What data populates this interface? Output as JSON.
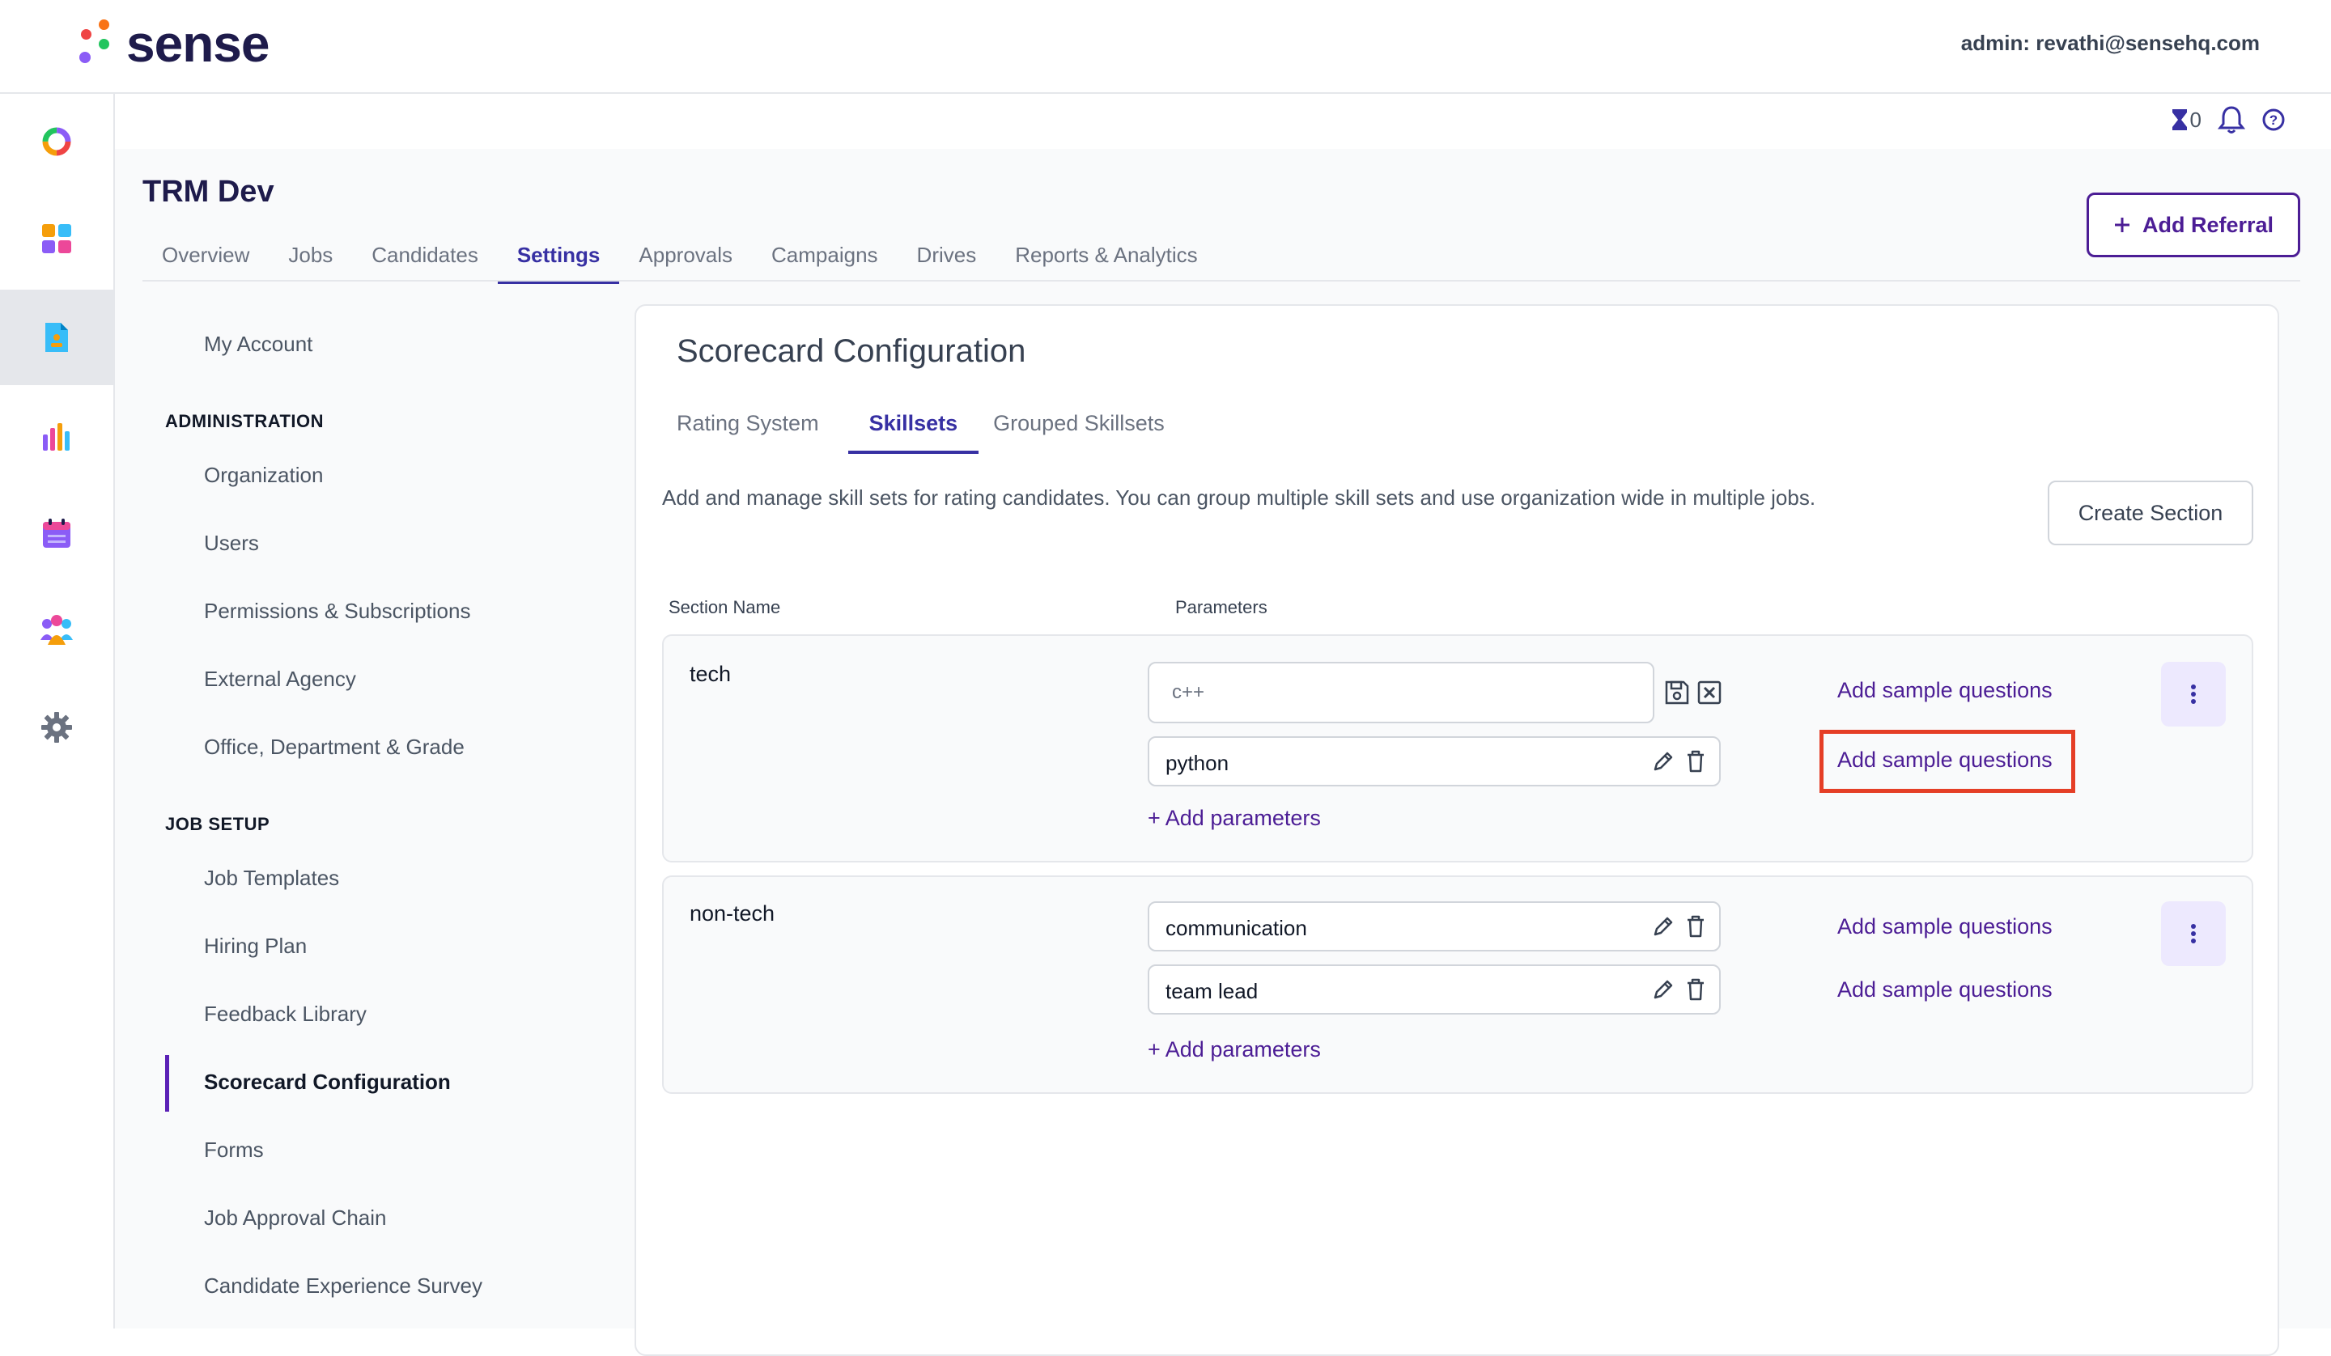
{
  "app": {
    "logo_text": "sense",
    "admin_label": "admin: revathi@sensehq.com",
    "notification_count": "0"
  },
  "rail": {
    "icons": [
      "donut-logo-icon",
      "dashboard-grid-icon",
      "document-icon",
      "analytics-icon",
      "calendar-icon",
      "people-icon",
      "settings-gear-icon"
    ],
    "active_index": 2
  },
  "header": {
    "title": "TRM Dev",
    "tabs": [
      "Overview",
      "Jobs",
      "Candidates",
      "Settings",
      "Approvals",
      "Campaigns",
      "Drives",
      "Reports & Analytics"
    ],
    "active_tab": "Settings",
    "add_referral_label": "Add Referral"
  },
  "settings_nav": {
    "my_account": "My Account",
    "administration_heading": "ADMINISTRATION",
    "administration": [
      "Organization",
      "Users",
      "Permissions & Subscriptions",
      "External Agency",
      "Office, Department & Grade"
    ],
    "job_setup_heading": "JOB SETUP",
    "job_setup": [
      "Job Templates",
      "Hiring Plan",
      "Feedback Library",
      "Scorecard Configuration",
      "Forms",
      "Job Approval Chain",
      "Candidate Experience Survey"
    ],
    "active_item": "Scorecard Configuration"
  },
  "scorecard": {
    "title": "Scorecard Configuration",
    "tabs": [
      "Rating System",
      "Skillsets",
      "Grouped Skillsets"
    ],
    "active_tab": "Skillsets",
    "description": "Add and manage skill sets for rating candidates. You can group multiple skill sets and use organization wide in multiple jobs.",
    "create_section_label": "Create Section",
    "col_section_name": "Section Name",
    "col_parameters": "Parameters",
    "add_parameters_label": "+ Add parameters",
    "add_sample_label": "Add sample questions",
    "sections": [
      {
        "name": "tech",
        "editing_value": "c++",
        "params": [
          "python"
        ]
      },
      {
        "name": "non-tech",
        "params": [
          "communication",
          "team lead"
        ]
      }
    ]
  },
  "colors": {
    "brand": "#3730a3",
    "accent_purple": "#4c1d95",
    "highlight": "#e53e26"
  }
}
